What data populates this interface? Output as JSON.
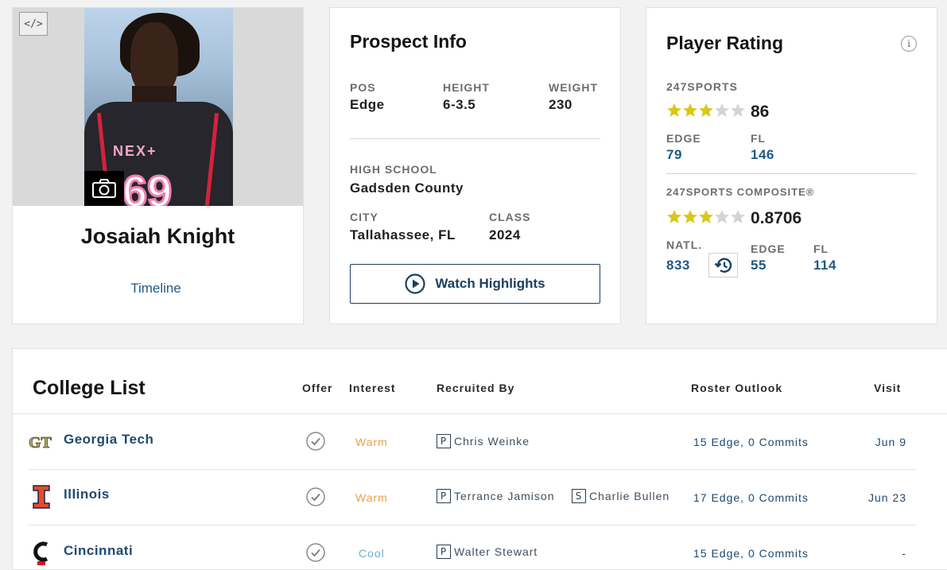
{
  "profile": {
    "name": "Josaiah Knight",
    "timeline_label": "Timeline",
    "embed_label": "</>",
    "jersey_brand": "NEX+",
    "jersey_number": "69",
    "camera_icon": "camera-icon"
  },
  "prospect": {
    "title": "Prospect Info",
    "pos_label": "POS",
    "pos": "Edge",
    "height_label": "HEIGHT",
    "height": "6-3.5",
    "weight_label": "WEIGHT",
    "weight": "230",
    "school_label": "HIGH SCHOOL",
    "school": "Gadsden County",
    "city_label": "CITY",
    "city": "Tallahassee, FL",
    "class_label": "CLASS",
    "class": "2024",
    "highlights_label": "Watch Highlights"
  },
  "rating": {
    "title": "Player Rating",
    "info_icon": "i",
    "s247": {
      "label": "247SPORTS",
      "stars": 3,
      "score": "86",
      "pos_label": "EDGE",
      "pos_rank": "79",
      "state_label": "FL",
      "state_rank": "146"
    },
    "composite": {
      "label": "247SPORTS COMPOSITE®",
      "stars": 3,
      "score": "0.8706",
      "natl_label": "NATL.",
      "natl_rank": "833",
      "pos_label": "EDGE",
      "pos_rank": "55",
      "state_label": "FL",
      "state_rank": "114"
    },
    "colors": {
      "star_on": "#d8c81a",
      "star_off": "#d4d4d4"
    }
  },
  "college_list": {
    "title": "College List",
    "headers": {
      "offer": "Offer",
      "interest": "Interest",
      "recruited_by": "Recruited By",
      "roster": "Roster Outlook",
      "visit": "Visit"
    },
    "rows": [
      {
        "school": "Georgia Tech",
        "logo": "georgia-tech-logo",
        "logo_text": "GT",
        "interest": "Warm",
        "recruiters": [
          {
            "role": "P",
            "name": "Chris Weinke"
          }
        ],
        "roster": "15 Edge, 0 Commits",
        "visit": "Jun 9"
      },
      {
        "school": "Illinois",
        "logo": "illinois-logo",
        "logo_text": "I",
        "interest": "Warm",
        "recruiters": [
          {
            "role": "P",
            "name": "Terrance Jamison"
          },
          {
            "role": "S",
            "name": "Charlie Bullen"
          }
        ],
        "roster": "17 Edge, 0 Commits",
        "visit": "Jun 23"
      },
      {
        "school": "Cincinnati",
        "logo": "cincinnati-logo",
        "logo_text": "C",
        "interest": "Cool",
        "recruiters": [
          {
            "role": "P",
            "name": "Walter Stewart"
          }
        ],
        "roster": "15 Edge, 0 Commits",
        "visit": "-"
      }
    ]
  }
}
